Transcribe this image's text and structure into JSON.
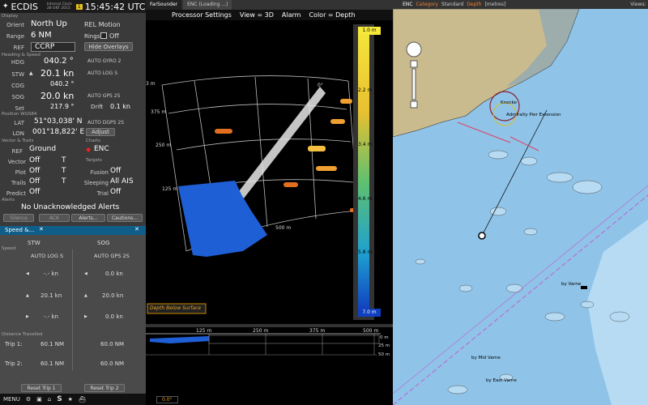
{
  "app": {
    "title": "ECDIS",
    "clock_label": "Internal Clock",
    "date": "28 OKT 2015",
    "time": "15:45:42 UTC",
    "alarm_badge": "1"
  },
  "display": {
    "section": "Display",
    "orient_label": "Orient",
    "orient": "North Up",
    "motion": "REL Motion",
    "range_label": "Range",
    "range": "6 NM",
    "rings_label": "Rings",
    "rings": "Off",
    "ref_label": "REF",
    "ref": "CCRP",
    "hide_overlays": "Hide Overlays"
  },
  "heading_speed": {
    "section": "Heading & Speed",
    "hdg_label": "HDG",
    "hdg": "040.2 °",
    "hdg_src": "AUTO GYRO 2",
    "stw_label": "STW",
    "stw": "20.1 kn",
    "stw_src": "AUTO LOG S",
    "cog_label": "COG",
    "cog": "040.2 °",
    "sog_label": "SOG",
    "sog": "20.0 kn",
    "sog_src": "AUTO GPS 2S",
    "set_label": "Set",
    "set": "217.9 °",
    "drift_label": "Drift",
    "drift": "0.1 kn"
  },
  "position": {
    "section": "Position WGS84",
    "lat_label": "LAT",
    "lat": "51°03,038' N",
    "lat_src": "AUTO DGPS 2S",
    "lon_label": "LON",
    "lon": "001°18,822' E",
    "adjust": "Adjust"
  },
  "vectors": {
    "section": "Vector & Trails",
    "ref_label": "REF",
    "ref": "Ground",
    "vector_label": "Vector",
    "vector": "Off",
    "vector_t": "T",
    "plot_label": "Plot",
    "plot": "Off",
    "plot_t": "T",
    "trails_label": "Trails",
    "trails": "Off",
    "trails_t": "T",
    "predict_label": "Predict",
    "predict": "Off"
  },
  "charts": {
    "section": "Charts",
    "chart": "ENC"
  },
  "targets": {
    "section": "Targets",
    "fusion_label": "Fusion",
    "fusion": "Off",
    "sleeping_label": "Sleeping",
    "sleeping": "All AIS",
    "trial_label": "Trial",
    "trial": "Off"
  },
  "alerts": {
    "section": "Alerts",
    "message": "No Unacknowledged Alerts",
    "silence": "Silence",
    "ack": "ACK",
    "alerts_btn": "Alerts...",
    "cautions_btn": "Cautions..."
  },
  "speed_panel": {
    "tab": "Speed &...",
    "col_stw": "STW",
    "col_sog": "SOG",
    "section_speed": "Speed",
    "stw_src": "AUTO LOG S",
    "sog_src": "AUTO GPS 2S",
    "stw_rows": [
      "-.- kn",
      "20.1 kn",
      "-.- kn"
    ],
    "sog_rows": [
      "0.0 kn",
      "20.0 kn",
      "0.0 kn"
    ],
    "distance_section": "Distance Travelled",
    "trip1_label": "Trip 1:",
    "trip1_stw": "60.1 NM",
    "trip1_sog": "60.0 NM",
    "trip2_label": "Trip 2:",
    "trip2_stw": "60.1 NM",
    "trip2_sog": "60.0 NM",
    "reset1": "Reset Trip 1",
    "reset2": "Reset Trip 2"
  },
  "bottombar": {
    "menu": "MENU",
    "s": "S"
  },
  "sonar": {
    "tab1": "FarSounder",
    "tab2": "ENC (Loading ...)",
    "menu": [
      "Processor Settings",
      "View = 3D",
      "Alarm",
      "Color = Depth"
    ],
    "range_labels": [
      "3 m",
      "375 m",
      "250 m",
      "125 m",
      "500 m"
    ],
    "angle_label": "0°",
    "depth_scale": [
      "1.0 m",
      "2.2 m",
      "3.4 m",
      "4.6 m",
      "5.8 m",
      "7.0 m"
    ],
    "depth_mode": "Depth Below Surface",
    "profile_ticks": [
      "125 m",
      "250 m",
      "375 m",
      "500 m"
    ],
    "profile_depths": [
      "0 m",
      "25 m",
      "50 m"
    ],
    "bottom_angle": "0.0°"
  },
  "enc": {
    "tab": "ENC",
    "category_label": "Category",
    "category": "Standard",
    "depth_label": "Depth",
    "depth_unit": "[metres]",
    "views_label": "Views:",
    "labels": {
      "knocke": "Knocke",
      "pier": "Admiralty Pier Extension",
      "varne": "by Varne",
      "mid_varne": "by Mid Varne",
      "east_varne": "by East Varne"
    }
  },
  "colors": {
    "sea": "#8fc3e8",
    "land": "#c9bb8e",
    "shallow": "#b7dbf2",
    "panel": "#3a3a3a",
    "speed_tab": "#0f5e8a",
    "sonar_blue": "#1f5fd6"
  }
}
